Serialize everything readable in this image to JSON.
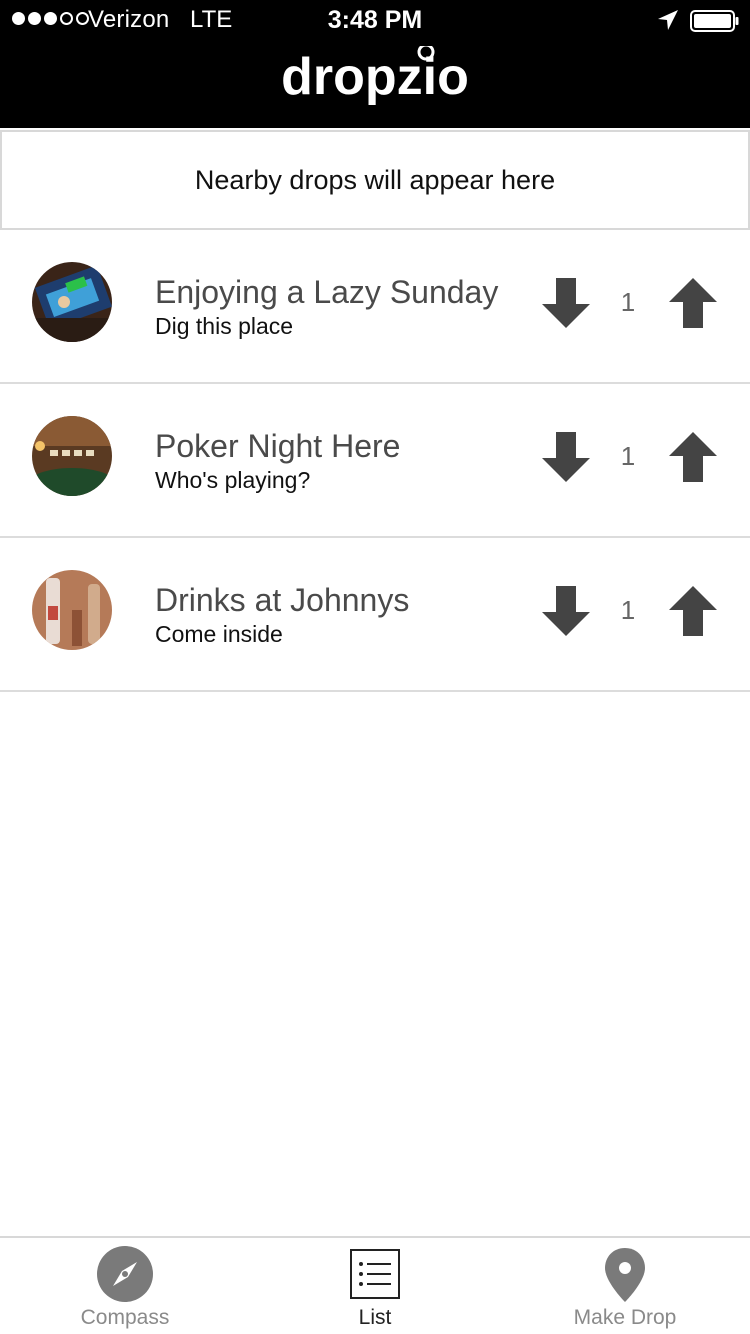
{
  "status_bar": {
    "carrier": "Verizon",
    "network": "LTE",
    "time": "3:48 PM",
    "signal_bars": 3,
    "signal_total": 5
  },
  "header": {
    "logo_text": "dropzio"
  },
  "banner": {
    "text": "Nearby drops will appear here"
  },
  "drops": [
    {
      "title": "Enjoying a Lazy Sunday",
      "subtitle": "Dig this place",
      "votes": "1",
      "image": "tv-screen-photo"
    },
    {
      "title": "Poker Night Here",
      "subtitle": "Who's playing?",
      "votes": "1",
      "image": "poker-room-photo"
    },
    {
      "title": "Drinks at Johnnys",
      "subtitle": "Come inside",
      "votes": "1",
      "image": "bottles-photo"
    }
  ],
  "tabs": [
    {
      "label": "Compass",
      "icon": "compass-icon",
      "active": false
    },
    {
      "label": "List",
      "icon": "list-icon",
      "active": true
    },
    {
      "label": "Make Drop",
      "icon": "map-pin-icon",
      "active": false
    }
  ],
  "colors": {
    "header_bg": "#000000",
    "arrow": "#444444",
    "divider": "#dcdcdc",
    "tab_inactive": "#8a8a8a",
    "tab_active": "#222222"
  }
}
